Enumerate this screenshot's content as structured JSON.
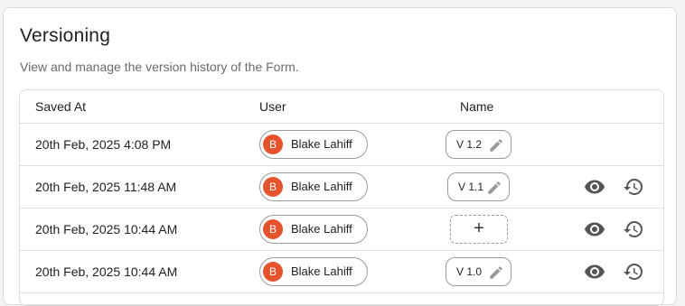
{
  "card": {
    "title": "Versioning",
    "subtitle": "View and manage the version history of the Form."
  },
  "table": {
    "headers": {
      "saved_at": "Saved At",
      "user": "User",
      "name": "Name"
    },
    "rows": [
      {
        "saved_at": "20th Feb, 2025 4:08 PM",
        "user": {
          "initial": "B",
          "name": "Blake Lahiff"
        },
        "version_name": "V 1.2",
        "has_name": true,
        "actions": false
      },
      {
        "saved_at": "20th Feb, 2025 11:48 AM",
        "user": {
          "initial": "B",
          "name": "Blake Lahiff"
        },
        "version_name": "V 1.1",
        "has_name": true,
        "actions": true
      },
      {
        "saved_at": "20th Feb, 2025 10:44 AM",
        "user": {
          "initial": "B",
          "name": "Blake Lahiff"
        },
        "add_label": "+",
        "has_name": false,
        "actions": true
      },
      {
        "saved_at": "20th Feb, 2025 10:44 AM",
        "user": {
          "initial": "B",
          "name": "Blake Lahiff"
        },
        "version_name": "V 1.0",
        "has_name": true,
        "actions": true
      }
    ]
  },
  "icons": {
    "edit": "pencil-icon",
    "view": "eye-icon",
    "restore": "history-restore-icon"
  },
  "colors": {
    "avatar": "#e5532c",
    "icon": "#555555",
    "border": "#dedede"
  }
}
